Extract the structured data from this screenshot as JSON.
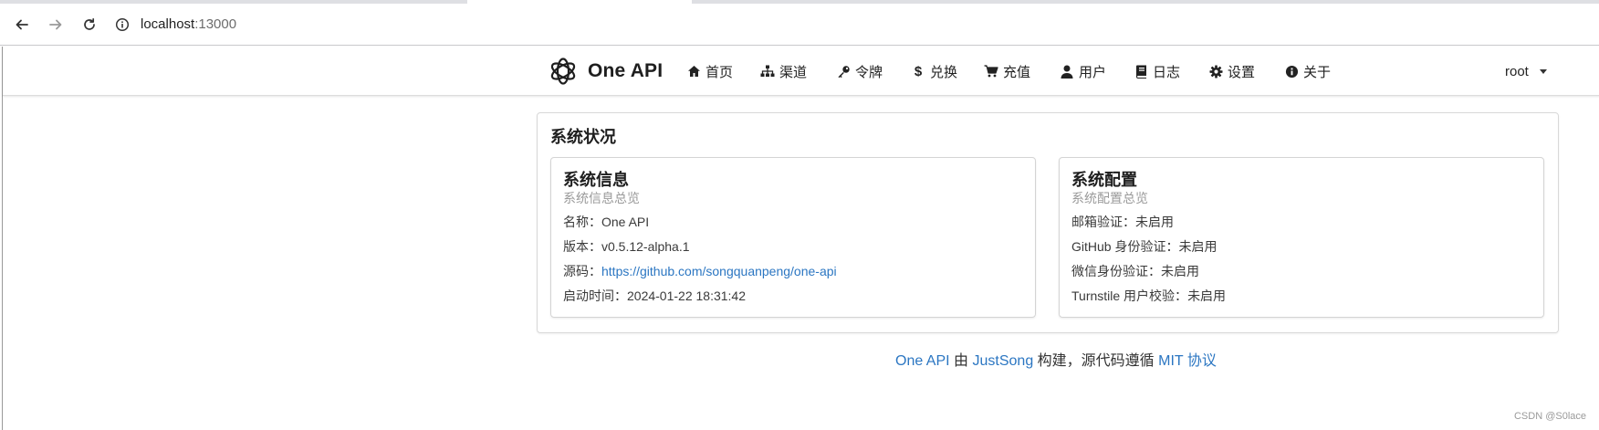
{
  "browser": {
    "url_host": "localhost",
    "url_port": ":13000"
  },
  "nav": {
    "brand": "One API",
    "items": [
      {
        "label": "首页",
        "icon": "home-icon"
      },
      {
        "label": "渠道",
        "icon": "sitemap-icon"
      },
      {
        "label": "令牌",
        "icon": "key-icon"
      },
      {
        "label": "兑换",
        "icon": "dollar-icon"
      },
      {
        "label": "充值",
        "icon": "cart-icon"
      },
      {
        "label": "用户",
        "icon": "user-icon"
      },
      {
        "label": "日志",
        "icon": "book-icon"
      },
      {
        "label": "设置",
        "icon": "gear-icon"
      },
      {
        "label": "关于",
        "icon": "info-icon"
      }
    ],
    "user": "root"
  },
  "status": {
    "title": "系统状况",
    "info": {
      "title": "系统信息",
      "subtitle": "系统信息总览",
      "name_label": "名称：",
      "name_value": "One API",
      "version_label": "版本：",
      "version_value": "v0.5.12-alpha.1",
      "source_label": "源码：",
      "source_value": "https://github.com/songquanpeng/one-api",
      "start_label": "启动时间：",
      "start_value": "2024-01-22 18:31:42"
    },
    "config": {
      "title": "系统配置",
      "subtitle": "系统配置总览",
      "email_label": "邮箱验证：",
      "email_value": "未启用",
      "github_label": "GitHub 身份验证：",
      "github_value": "未启用",
      "wechat_label": "微信身份验证：",
      "wechat_value": "未启用",
      "turnstile_label": "Turnstile 用户校验：",
      "turnstile_value": "未启用"
    }
  },
  "footer": {
    "app_link": "One API",
    "by": " 由 ",
    "author_link": "JustSong",
    "middle": " 构建，源代码遵循 ",
    "license_link": "MIT 协议"
  },
  "watermark": "CSDN @S0lace"
}
